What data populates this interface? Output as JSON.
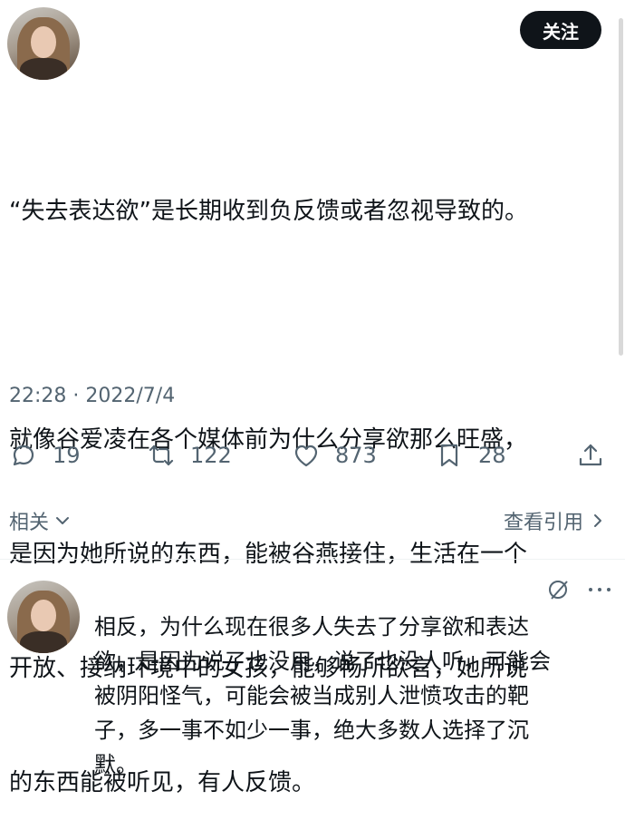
{
  "header": {
    "follow_label": "关注"
  },
  "tweet": {
    "line1": "“失去表达欲”是长期收到负反馈或者忽视导致的。",
    "line2": "就像谷爱凌在各个媒体前为什么分享欲那么旺盛，",
    "line3": "是因为她所说的东西，能被谷燕接住，生活在一个",
    "line4": "开放、接纳环境中的女孩，能够畅所欲言，她所说",
    "line5": "的东西能被听见，有人反馈。",
    "timestamp": "22:28 · 2022/7/4"
  },
  "actions": {
    "replies": "19",
    "retweets": "122",
    "likes": "873",
    "bookmarks": "28"
  },
  "links": {
    "related": "相关",
    "quotes": "查看引用"
  },
  "reply": {
    "line1": "相反，为什么现在很多人失去了分享欲和表达",
    "line2": "欲，是因为说了也没用，说了也没人听，可能会",
    "line3": "被阴阳怪气，可能会被当成别人泄愤攻击的靶",
    "line4": "子，多一事不如少一事，绝大多数人选择了沉",
    "line5": "默。"
  },
  "icons": {
    "reply": "comment-icon",
    "retweet": "retweet-icon",
    "like": "heart-icon",
    "bookmark": "bookmark-icon",
    "share": "share-icon",
    "chevron_down": "chevron-down-icon",
    "chevron_right": "chevron-right-icon",
    "grok": "grok-icon",
    "more": "more-icon"
  }
}
